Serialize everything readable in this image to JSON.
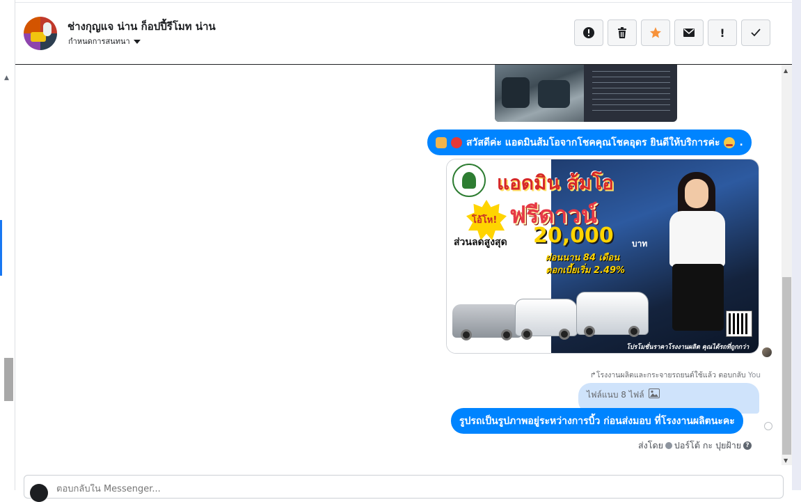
{
  "header": {
    "title": "ช่างกุญแจ น่าน ก็อปปี้รีโมท น่าน",
    "subtitle": "กำหนดการสนทนา"
  },
  "messages": {
    "greeting": "สวัสดีค่ะ แอดมินส้มโอจากโชคคุณโชคอุดร ยินดีให้บริการค่ะ",
    "promo": {
      "title": "แอดมิน ส้มโอ",
      "badge": "โอ้โห!",
      "free_down": "ฟรีดาวน์",
      "discount_label": "ส่วนลดสูงสุด",
      "amount": "20,000",
      "baht": "บาท",
      "installment": "ผ่อนนาน 84 เดือน",
      "interest": "ดอกเบี้ยเริ่ม 2.49%",
      "footer": "โปรโมชั่นราคาโรงงานผลิต คุณได้รถที่ถูกกว่า"
    },
    "reply_info": "โรงงานผลิตและกระจายรถยนต์ใช้แล้ว ตอบกลับ",
    "reply_you": "You",
    "attachment": "ไฟล์แนบ 8 ไฟล์",
    "car_message": "รูปรถเป็นรูปภาพอยู่ระหว่างการบิ้ว ก่อนส่งมอบ ที่โรงงานผลิตนะคะ",
    "sent_by_label": "ส่งโดย",
    "sent_by_name": "ปอร์โต้ กะ ปุยฝ้าย"
  },
  "composer": {
    "placeholder": "ตอบกลับใน Messenger..."
  },
  "colors": {
    "bubble": "#0084ff",
    "reply_bubble": "#cfe3fb",
    "star": "#f7923a"
  },
  "icons": {
    "spam": "exclamation-circle-icon",
    "delete": "trash-icon",
    "star": "star-icon",
    "mail": "envelope-icon",
    "important": "exclamation-icon",
    "done": "checkmark-icon"
  }
}
